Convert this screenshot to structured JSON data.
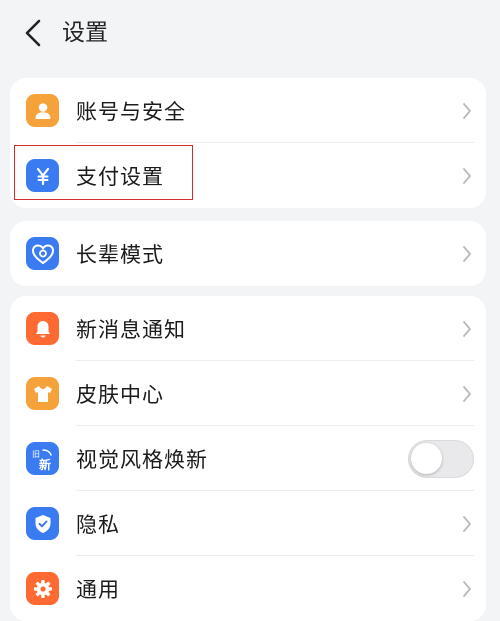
{
  "header": {
    "title": "设置"
  },
  "groups": [
    {
      "items": [
        {
          "label": "账号与安全",
          "icon": "person-icon",
          "color": "#f6a23a"
        },
        {
          "label": "支付设置",
          "icon": "yuan-icon",
          "color": "#3b7bf2"
        }
      ]
    },
    {
      "items": [
        {
          "label": "长辈模式",
          "icon": "elder-heart-icon",
          "color": "#3b7bf2"
        }
      ]
    },
    {
      "items": [
        {
          "label": "新消息通知",
          "icon": "bell-icon",
          "color": "#ff6a33"
        },
        {
          "label": "皮肤中心",
          "icon": "tshirt-icon",
          "color": "#f6a23a"
        },
        {
          "label": "视觉风格焕新",
          "icon": "old-new-icon",
          "color": "#3b7bf2",
          "toggle": false
        },
        {
          "label": "隐私",
          "icon": "shield-check-icon",
          "color": "#3b7bf2"
        },
        {
          "label": "通用",
          "icon": "gear-icon",
          "color": "#ff6a33"
        }
      ]
    }
  ],
  "icon_text": {
    "old": "旧",
    "new": "新"
  },
  "highlighted_item": "支付设置"
}
